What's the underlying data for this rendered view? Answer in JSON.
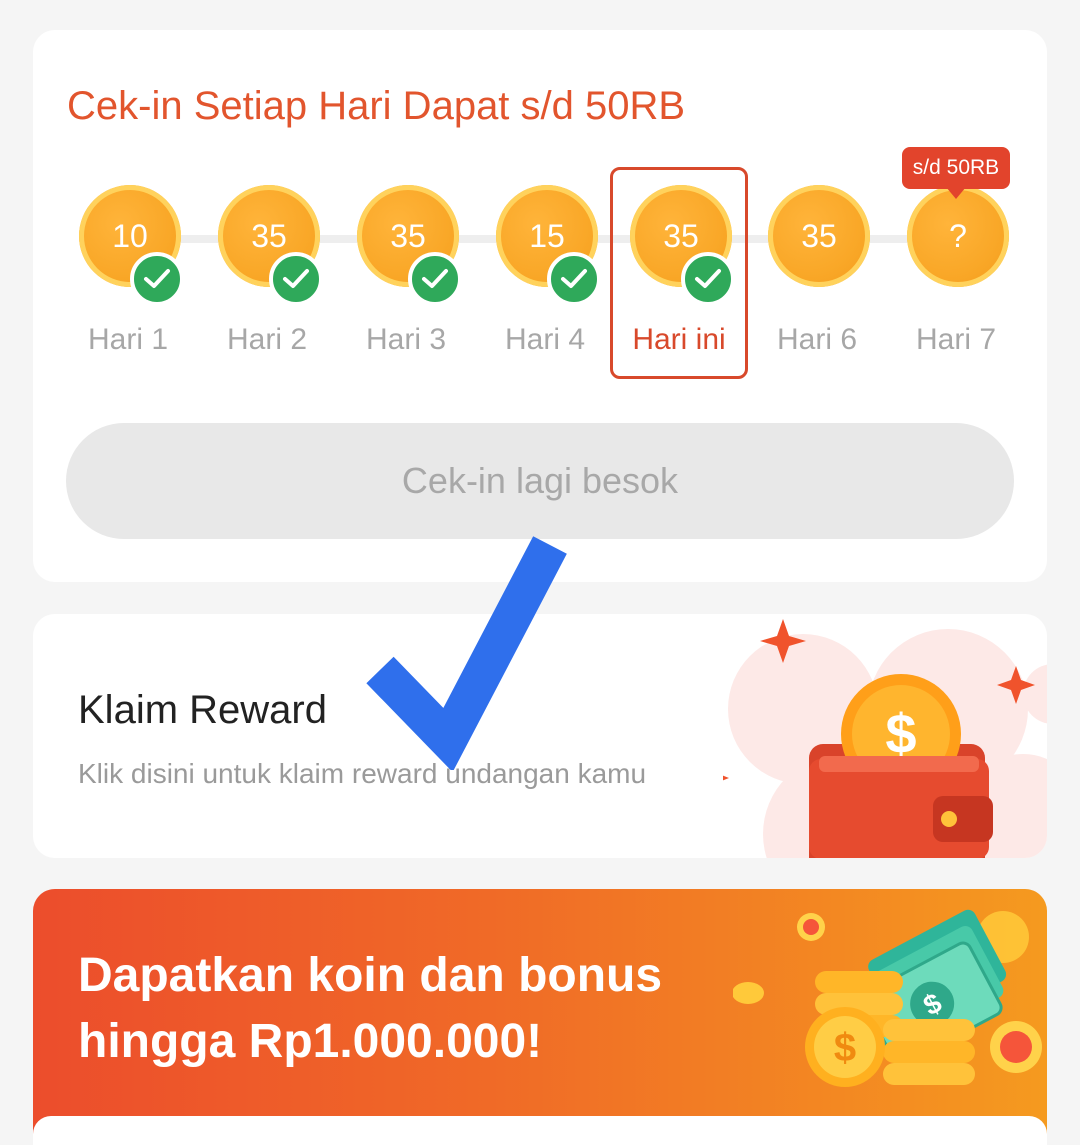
{
  "checkin": {
    "title": "Cek-in Setiap Hari Dapat s/d 50RB",
    "bubble": "s/d 50RB",
    "days": [
      {
        "value": "10",
        "label": "Hari 1",
        "checked": true
      },
      {
        "value": "35",
        "label": "Hari 2",
        "checked": true
      },
      {
        "value": "35",
        "label": "Hari 3",
        "checked": true
      },
      {
        "value": "15",
        "label": "Hari 4",
        "checked": true
      },
      {
        "value": "35",
        "label": "Hari ini",
        "checked": true,
        "today": true
      },
      {
        "value": "35",
        "label": "Hari 6",
        "checked": false
      },
      {
        "value": "?",
        "label": "Hari 7",
        "checked": false
      }
    ],
    "button_label": "Cek-in lagi besok"
  },
  "reward": {
    "title": "Klaim Reward",
    "subtitle": "Klik disini untuk klaim reward undangan kamu",
    "wallet_coin_symbol": "$"
  },
  "promo": {
    "line1": "Dapatkan koin dan bonus",
    "line2": "hingga Rp1.000.000!",
    "coin_symbol": "$"
  },
  "colors": {
    "accent": "#e2552d",
    "check_green": "#2fa95a",
    "coin": "#f9a727",
    "overlay_check": "#2f6fec"
  }
}
